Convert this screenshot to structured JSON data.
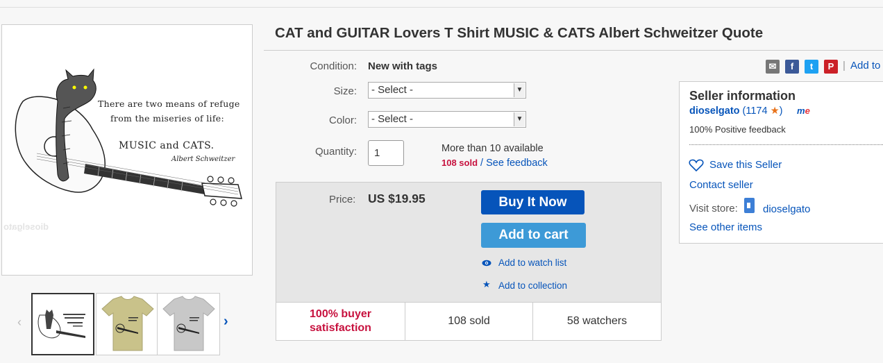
{
  "product": {
    "title": "CAT and GUITAR Lovers T Shirt MUSIC & CATS Albert Schweitzer Quote",
    "image": {
      "quote_line1": "There are two means of refuge",
      "quote_line2": "from the miseries of life:",
      "quote_line3": "MUSIC and CATS.",
      "quote_author": "Albert Schweitzer",
      "watermark": "dioselgato"
    },
    "thumbnails": [
      "cat-guitar-design",
      "tan-shirt",
      "gray-shirt"
    ]
  },
  "details": {
    "condition_label": "Condition:",
    "condition_value": "New with tags",
    "size_label": "Size:",
    "size_select": "- Select -",
    "color_label": "Color:",
    "color_select": "- Select -",
    "quantity_label": "Quantity:",
    "quantity_value": "1",
    "availability": "More than 10 available",
    "sold_count": "108 sold",
    "sold_sep": " / ",
    "see_feedback": "See feedback"
  },
  "purchase": {
    "price_label": "Price:",
    "price_value": "US $19.95",
    "buy_now": "Buy It Now",
    "add_to_cart": "Add to cart",
    "add_watch": "Add to watch list",
    "add_collection": "Add to collection",
    "stats": {
      "satisfaction_line1": "100% buyer",
      "satisfaction_line2": "satisfaction",
      "sold": "108 sold",
      "watchers": "58 watchers"
    }
  },
  "share": {
    "separator": "|",
    "add_to": "Add to"
  },
  "seller": {
    "heading": "Seller information",
    "name": "dioselgato",
    "score_open": " (1174 ",
    "score_close": ")",
    "me_m": "m",
    "me_e": "e",
    "positive": "100% Positive feedback",
    "save": "Save this Seller",
    "contact": "Contact seller",
    "visit_label": "Visit store:",
    "store_name": "dioselgato",
    "other_items": "See other items"
  },
  "colors": {
    "link": "#0654ba",
    "buy_button": "#0654ba",
    "cart_button": "#3d9ad7",
    "alert_red": "#c7113e"
  }
}
